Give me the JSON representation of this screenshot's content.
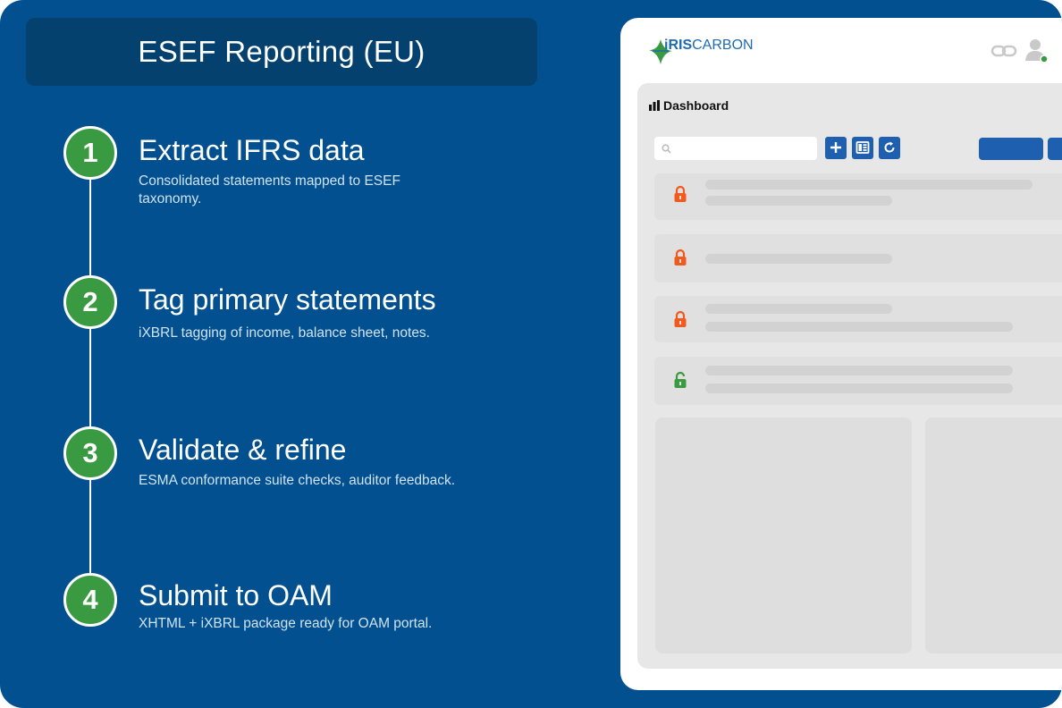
{
  "header": {
    "title": "ESEF Reporting (EU)"
  },
  "steps": [
    {
      "number": "1",
      "title": "Extract IFRS data",
      "description": "Consolidated statements mapped to ESEF taxonomy."
    },
    {
      "number": "2",
      "title": "Tag primary statements",
      "description": "iXBRL tagging of income, balance sheet, notes."
    },
    {
      "number": "3",
      "title": "Validate & refine",
      "description": "ESMA conformance suite checks, auditor feedback."
    },
    {
      "number": "4",
      "title": "Submit to OAM",
      "description": "XHTML + iXBRL package ready for OAM portal."
    }
  ],
  "app": {
    "logo": {
      "prefix": "iRIS",
      "suffix": "CARBON"
    },
    "dashboard_title": "Dashboard",
    "rows": [
      {
        "lock_status": "locked",
        "lock_color": "#f05a1e"
      },
      {
        "lock_status": "locked",
        "lock_color": "#f05a1e"
      },
      {
        "lock_status": "locked",
        "lock_color": "#f05a1e"
      },
      {
        "lock_status": "unlocked",
        "lock_color": "#3a9a41"
      }
    ],
    "icons": [
      "search-icon",
      "plus-icon",
      "layout-icon",
      "refresh-icon",
      "link-icon",
      "user-icon",
      "bar-chart-icon",
      "lock-icon"
    ]
  },
  "colors": {
    "background": "#02508f",
    "title_box": "#04416f",
    "step_circle": "#3a9a41",
    "accent_blue": "#1f5fb0",
    "online_dot": "#3a9a41"
  }
}
